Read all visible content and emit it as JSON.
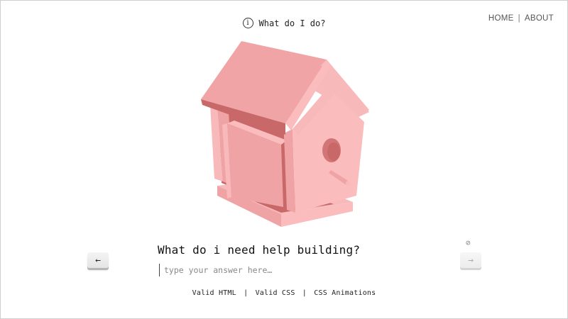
{
  "nav": {
    "home": "HOME",
    "separator": "|",
    "about": "ABOUT"
  },
  "header": {
    "info_icon": "info-icon",
    "info_glyph": "i",
    "title": "What do I do?"
  },
  "illustration": {
    "subject": "birdhouse-icon",
    "colors": {
      "roof_top": "#f0a4a6",
      "roof_light": "#f8b9ba",
      "wall_front": "#fbbcbd",
      "wall_side": "#f0a3a4",
      "shadow": "#c96868",
      "hole": "#d27577"
    }
  },
  "question": {
    "text": "What do i need help building?",
    "placeholder": "type your answer here…",
    "value": ""
  },
  "controls": {
    "prev_icon": "arrow-left-icon",
    "prev_glyph": "←",
    "next_icon": "arrow-right-icon",
    "next_glyph": "→",
    "disabled_icon": "disabled-icon",
    "disabled_glyph": "⊘"
  },
  "footer": {
    "links": [
      "Valid HTML",
      "Valid CSS",
      "CSS Animations"
    ],
    "separator": "|"
  }
}
